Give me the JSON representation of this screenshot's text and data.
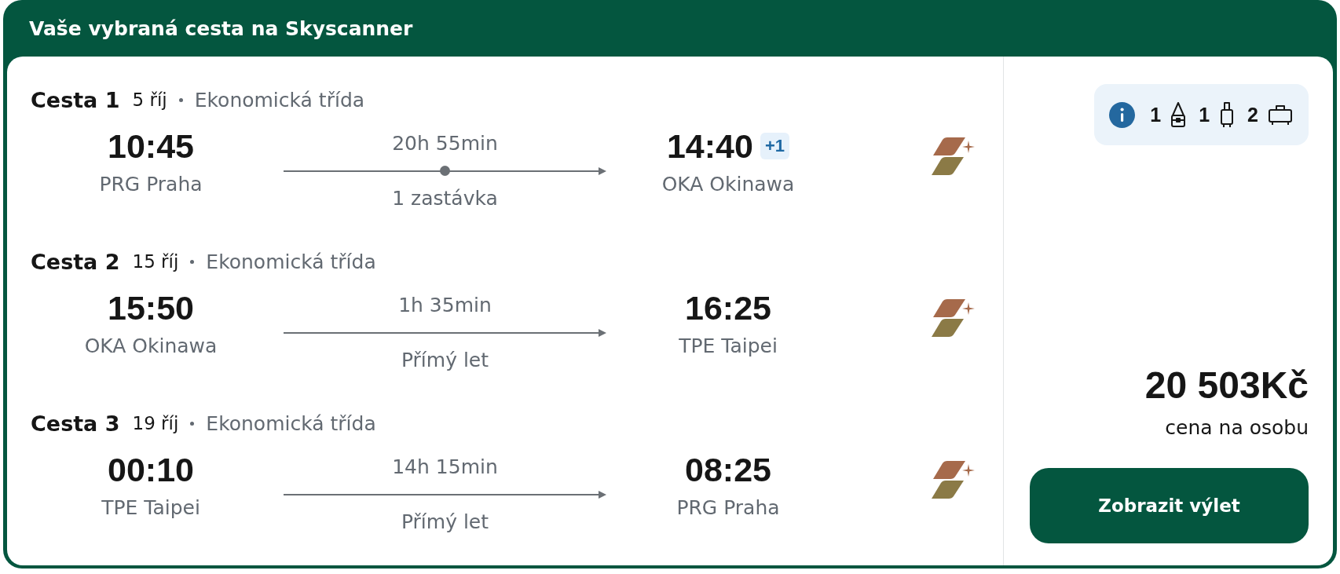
{
  "header": {
    "title": "Vaše vybraná cesta na Skyscanner"
  },
  "legs": [
    {
      "label": "Cesta 1",
      "date": "5 říj",
      "cabin_class": "Ekonomická třída",
      "departure": {
        "time": "10:45",
        "airport": "PRG Praha"
      },
      "duration": "20h 55min",
      "stopover": true,
      "stops": "1 zastávka",
      "arrival": {
        "time": "14:40",
        "day_offset": "+1",
        "airport": "OKA Okinawa"
      }
    },
    {
      "label": "Cesta 2",
      "date": "15 říj",
      "cabin_class": "Ekonomická třída",
      "departure": {
        "time": "15:50",
        "airport": "OKA Okinawa"
      },
      "duration": "1h 35min",
      "stopover": false,
      "stops": "Přímý let",
      "arrival": {
        "time": "16:25",
        "airport": "TPE Taipei"
      }
    },
    {
      "label": "Cesta 3",
      "date": "19 říj",
      "cabin_class": "Ekonomická třída",
      "departure": {
        "time": "00:10",
        "airport": "TPE Taipei"
      },
      "duration": "14h 15min",
      "stopover": false,
      "stops": "Přímý let",
      "arrival": {
        "time": "08:25",
        "airport": "PRG Praha"
      }
    }
  ],
  "baggage": [
    {
      "kind": "personal",
      "count": "1"
    },
    {
      "kind": "cabin",
      "count": "1"
    },
    {
      "kind": "checked",
      "count": "2"
    }
  ],
  "price": {
    "amount": "20 503Kč",
    "note": "cena na osobu"
  },
  "button": {
    "label": "Zobrazit výlet"
  }
}
